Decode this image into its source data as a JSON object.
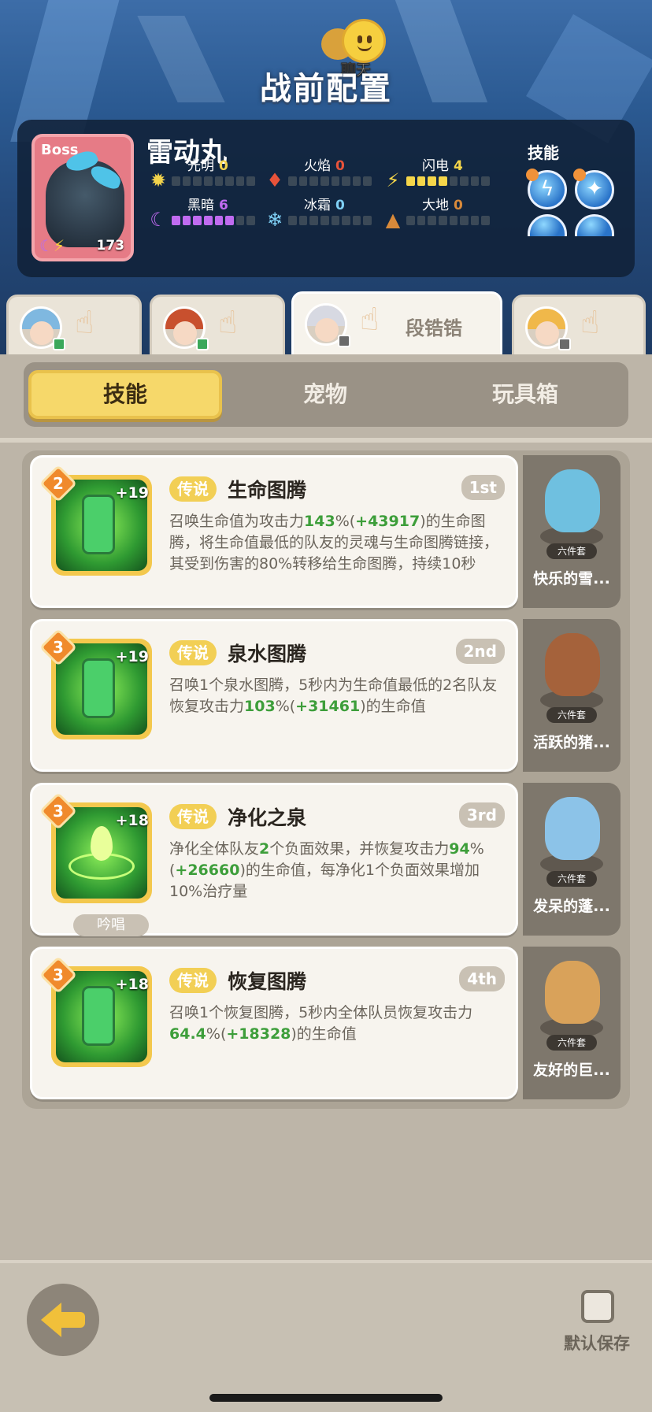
{
  "chat": {
    "label": "聊天"
  },
  "page_title": "战前配置",
  "boss": {
    "tag": "Boss",
    "name": "雷动丸",
    "level": "173",
    "elements": [
      {
        "name": "光明",
        "value": "0",
        "icon": "sun-icon",
        "filled": 0,
        "color": "#f2d34c"
      },
      {
        "name": "火焰",
        "value": "0",
        "icon": "fire-icon",
        "filled": 0,
        "color": "#e8533a"
      },
      {
        "name": "闪电",
        "value": "4",
        "icon": "lightning-icon",
        "filled": 4,
        "color": "#f5d64a"
      },
      {
        "name": "黑暗",
        "value": "6",
        "icon": "moon-icon",
        "filled": 6,
        "color": "#c06bf0"
      },
      {
        "name": "冰霜",
        "value": "0",
        "icon": "snowflake-icon",
        "filled": 0,
        "color": "#7fd0f5"
      },
      {
        "name": "大地",
        "value": "0",
        "icon": "earth-icon",
        "filled": 0,
        "color": "#d98a3a"
      }
    ],
    "skills_label": "技能"
  },
  "hero_tabs": [
    {
      "name": "",
      "icon": "hero-avatar-blue"
    },
    {
      "name": "",
      "icon": "hero-avatar-red"
    },
    {
      "name": "段锆锆",
      "icon": "hero-avatar-white",
      "active": true
    },
    {
      "name": "",
      "icon": "hero-avatar-blonde"
    }
  ],
  "categories": [
    {
      "label": "技能",
      "active": true
    },
    {
      "label": "宠物",
      "active": false
    },
    {
      "label": "玩具箱",
      "active": false
    }
  ],
  "skills": [
    {
      "level": "2",
      "plus": "+19",
      "rarity": "传说",
      "name": "生命图腾",
      "rank": "1st",
      "desc_parts": [
        {
          "t": "召唤生命值为攻击力",
          "hl": false
        },
        {
          "t": "143",
          "hl": true
        },
        {
          "t": "%(",
          "hl": false
        },
        {
          "t": "+43917",
          "hl": true
        },
        {
          "t": ")的生命图腾，将生命值最低的队友的灵魂与生命图腾链接，其受到伤害的80%转移给生命图腾，持续10秒",
          "hl": false
        }
      ],
      "chant": "",
      "pet": {
        "name": "快乐的雪...",
        "set": "六件套",
        "color": "#6fc0e0"
      }
    },
    {
      "level": "3",
      "plus": "+19",
      "rarity": "传说",
      "name": "泉水图腾",
      "rank": "2nd",
      "desc_parts": [
        {
          "t": "召唤1个泉水图腾，5秒内为生命值最低的2名队友恢复攻击力",
          "hl": false
        },
        {
          "t": "103",
          "hl": true
        },
        {
          "t": "%(",
          "hl": false
        },
        {
          "t": "+31461",
          "hl": true
        },
        {
          "t": ")的生命值",
          "hl": false
        }
      ],
      "chant": "",
      "pet": {
        "name": "活跃的猪...",
        "set": "六件套",
        "color": "#a5623b"
      }
    },
    {
      "level": "3",
      "plus": "+18",
      "rarity": "传说",
      "name": "净化之泉",
      "rank": "3rd",
      "desc_parts": [
        {
          "t": "净化全体队友",
          "hl": false
        },
        {
          "t": "2",
          "hl": true
        },
        {
          "t": "个负面效果，并恢复攻击力",
          "hl": false
        },
        {
          "t": "94",
          "hl": true
        },
        {
          "t": "%(",
          "hl": false
        },
        {
          "t": "+26660",
          "hl": true
        },
        {
          "t": ")的生命值，每净化1个负面效果增加10%治疗量",
          "hl": false
        }
      ],
      "chant": "吟唱",
      "pet": {
        "name": "发呆的蓬...",
        "set": "六件套",
        "color": "#8cc3e8"
      }
    },
    {
      "level": "3",
      "plus": "+18",
      "rarity": "传说",
      "name": "恢复图腾",
      "rank": "4th",
      "desc_parts": [
        {
          "t": "召唤1个恢复图腾，5秒内全体队员恢复攻击力",
          "hl": false
        },
        {
          "t": "64.4",
          "hl": true
        },
        {
          "t": "%(",
          "hl": false
        },
        {
          "t": "+18328",
          "hl": true
        },
        {
          "t": ")的生命值",
          "hl": false
        }
      ],
      "chant": "",
      "pet": {
        "name": "友好的巨...",
        "set": "六件套",
        "color": "#d9a25a"
      }
    }
  ],
  "bottom": {
    "save_label": "默认保存"
  }
}
